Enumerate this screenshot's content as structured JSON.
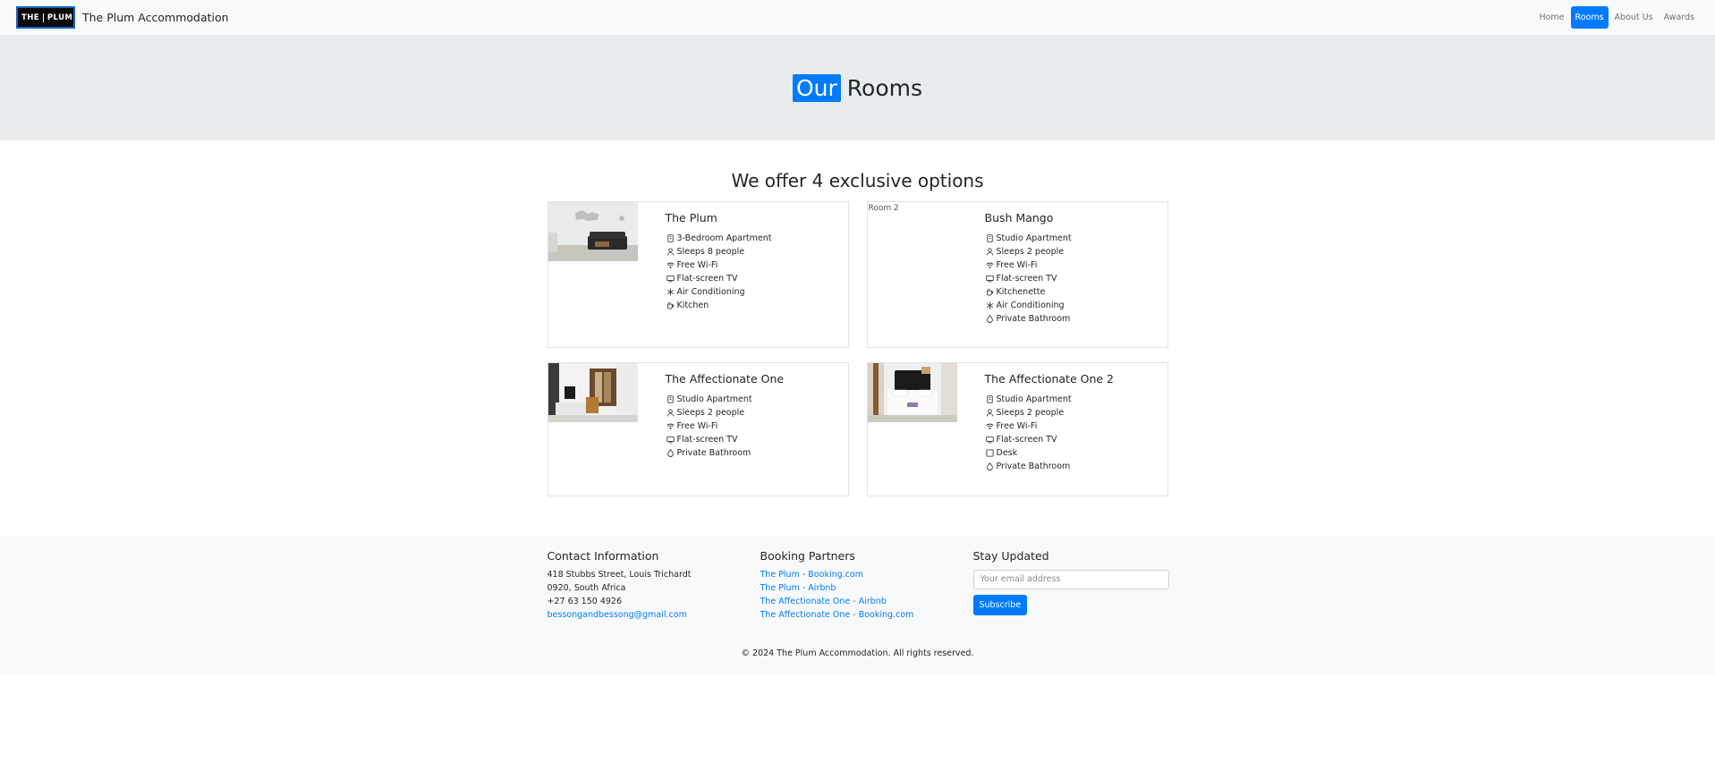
{
  "navbar": {
    "logo": {
      "the": "THE",
      "plum": "PLUM"
    },
    "brand_name": "The Plum Accommodation",
    "links": [
      {
        "label": "Home",
        "active": false
      },
      {
        "label": "Rooms",
        "active": true
      },
      {
        "label": "About Us",
        "active": false
      },
      {
        "label": "Awards",
        "active": false
      }
    ]
  },
  "hero": {
    "highlight": "Our",
    "title_rest": "Rooms"
  },
  "section": {
    "title": "We offer 4 exclusive options"
  },
  "rooms": [
    {
      "name": "The Plum",
      "image": "living-room-photo",
      "features": [
        {
          "icon": "building-icon",
          "text": "3-Bedroom Apartment"
        },
        {
          "icon": "person-icon",
          "text": "Sleeps 8 people"
        },
        {
          "icon": "wifi-icon",
          "text": "Free Wi-Fi"
        },
        {
          "icon": "tv-icon",
          "text": "Flat-screen TV"
        },
        {
          "icon": "snowflake-icon",
          "text": "Air Conditioning"
        },
        {
          "icon": "cup-icon",
          "text": "Kitchen"
        }
      ]
    },
    {
      "name": "Bush Mango",
      "image_alt": "Room 2",
      "features": [
        {
          "icon": "building-icon",
          "text": "Studio Apartment"
        },
        {
          "icon": "person-icon",
          "text": "Sleeps 2 people"
        },
        {
          "icon": "wifi-icon",
          "text": "Free Wi-Fi"
        },
        {
          "icon": "tv-icon",
          "text": "Flat-screen TV"
        },
        {
          "icon": "cup-icon",
          "text": "Kitchenette"
        },
        {
          "icon": "snowflake-icon",
          "text": "Air Conditioning"
        },
        {
          "icon": "droplet-icon",
          "text": "Private Bathroom"
        }
      ]
    },
    {
      "name": "The Affectionate One",
      "image": "studio-room-photo",
      "features": [
        {
          "icon": "building-icon",
          "text": "Studio Apartment"
        },
        {
          "icon": "person-icon",
          "text": "Sleeps 2 people"
        },
        {
          "icon": "wifi-icon",
          "text": "Free Wi-Fi"
        },
        {
          "icon": "tv-icon",
          "text": "Flat-screen TV"
        },
        {
          "icon": "droplet-icon",
          "text": "Private Bathroom"
        }
      ]
    },
    {
      "name": "The Affectionate One 2",
      "image": "bedroom-photo",
      "features": [
        {
          "icon": "building-icon",
          "text": "Studio Apartment"
        },
        {
          "icon": "person-icon",
          "text": "Sleeps 2 people"
        },
        {
          "icon": "wifi-icon",
          "text": "Free Wi-Fi"
        },
        {
          "icon": "tv-icon",
          "text": "Flat-screen TV"
        },
        {
          "icon": "square-icon",
          "text": "Desk"
        },
        {
          "icon": "droplet-icon",
          "text": "Private Bathroom"
        }
      ]
    }
  ],
  "footer": {
    "contact": {
      "title": "Contact Information",
      "address1": "418 Stubbs Street, Louis Trichardt",
      "address2": "0920, South Africa",
      "phone": "+27 63 150 4926",
      "email": "bessongandbessong@gmail.com"
    },
    "partners": {
      "title": "Booking Partners",
      "links": [
        "The Plum - Booking.com",
        "The Plum - Airbnb",
        "The Affectionate One - Airbnb",
        "The Affectionate One - Booking.com"
      ]
    },
    "newsletter": {
      "title": "Stay Updated",
      "placeholder": "Your email address",
      "button": "Subscribe"
    },
    "copyright": "© 2024 The Plum Accommodation. All rights reserved."
  },
  "colors": {
    "accent": "#007bff",
    "hero_bg": "#e9ecef",
    "footer_bg": "#f8f9fa"
  }
}
